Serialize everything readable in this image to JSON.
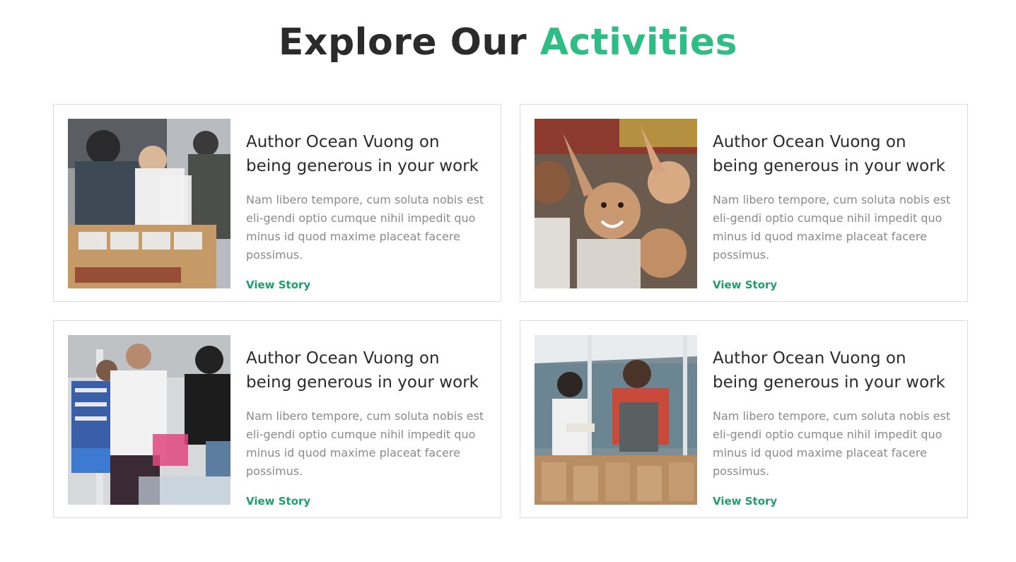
{
  "section": {
    "title_main": "Explore Our ",
    "title_accent": "Activities",
    "accent_color": "#2ebd85"
  },
  "cards": [
    {
      "image_icon": "food-distribution-photo",
      "title": "Author Ocean Vuong on being generous in your work",
      "text": "Nam libero tempore, cum soluta nobis est eli-gendi optio cumque nihil impedit quo minus id quod maxime placeat facere possimus.",
      "link": "View Story"
    },
    {
      "image_icon": "smiling-children-photo",
      "title": "Author Ocean Vuong on being generous in your work",
      "text": "Nam libero tempore, cum soluta nobis est eli-gendi optio cumque nihil impedit quo minus id quod maxime placeat facere possimus.",
      "link": "View Story"
    },
    {
      "image_icon": "volunteers-helping-photo",
      "title": "Author Ocean Vuong on being generous in your work",
      "text": "Nam libero tempore, cum soluta nobis est eli-gendi optio cumque nihil impedit quo minus id quod maxime placeat facere possimus.",
      "link": "View Story"
    },
    {
      "image_icon": "packing-bags-photo",
      "title": "Author Ocean Vuong on being generous in your work",
      "text": "Nam libero tempore, cum soluta nobis est eli-gendi optio cumque nihil impedit quo minus id quod maxime placeat facere possimus.",
      "link": "View Story"
    }
  ]
}
